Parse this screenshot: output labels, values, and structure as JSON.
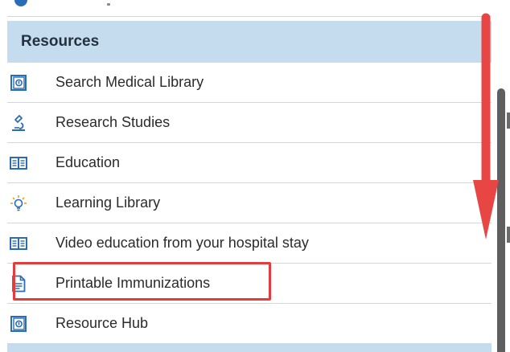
{
  "section": {
    "title": "Resources"
  },
  "items": [
    {
      "label": "Search Medical Library",
      "icon": "library-book-icon"
    },
    {
      "label": "Research Studies",
      "icon": "microscope-icon"
    },
    {
      "label": "Education",
      "icon": "open-book-icon"
    },
    {
      "label": "Learning Library",
      "icon": "lightbulb-icon"
    },
    {
      "label": "Video education from your hospital stay",
      "icon": "open-book-icon"
    },
    {
      "label": "Printable Immunizations",
      "icon": "document-icon"
    },
    {
      "label": "Resource Hub",
      "icon": "library-book-icon"
    }
  ],
  "colors": {
    "header_bg": "#c4dcee",
    "icon_blue": "#2a6cb5",
    "highlight_red": "#e23c3c",
    "arrow_red": "#e84545",
    "scrollbar": "#5f5f5f"
  }
}
